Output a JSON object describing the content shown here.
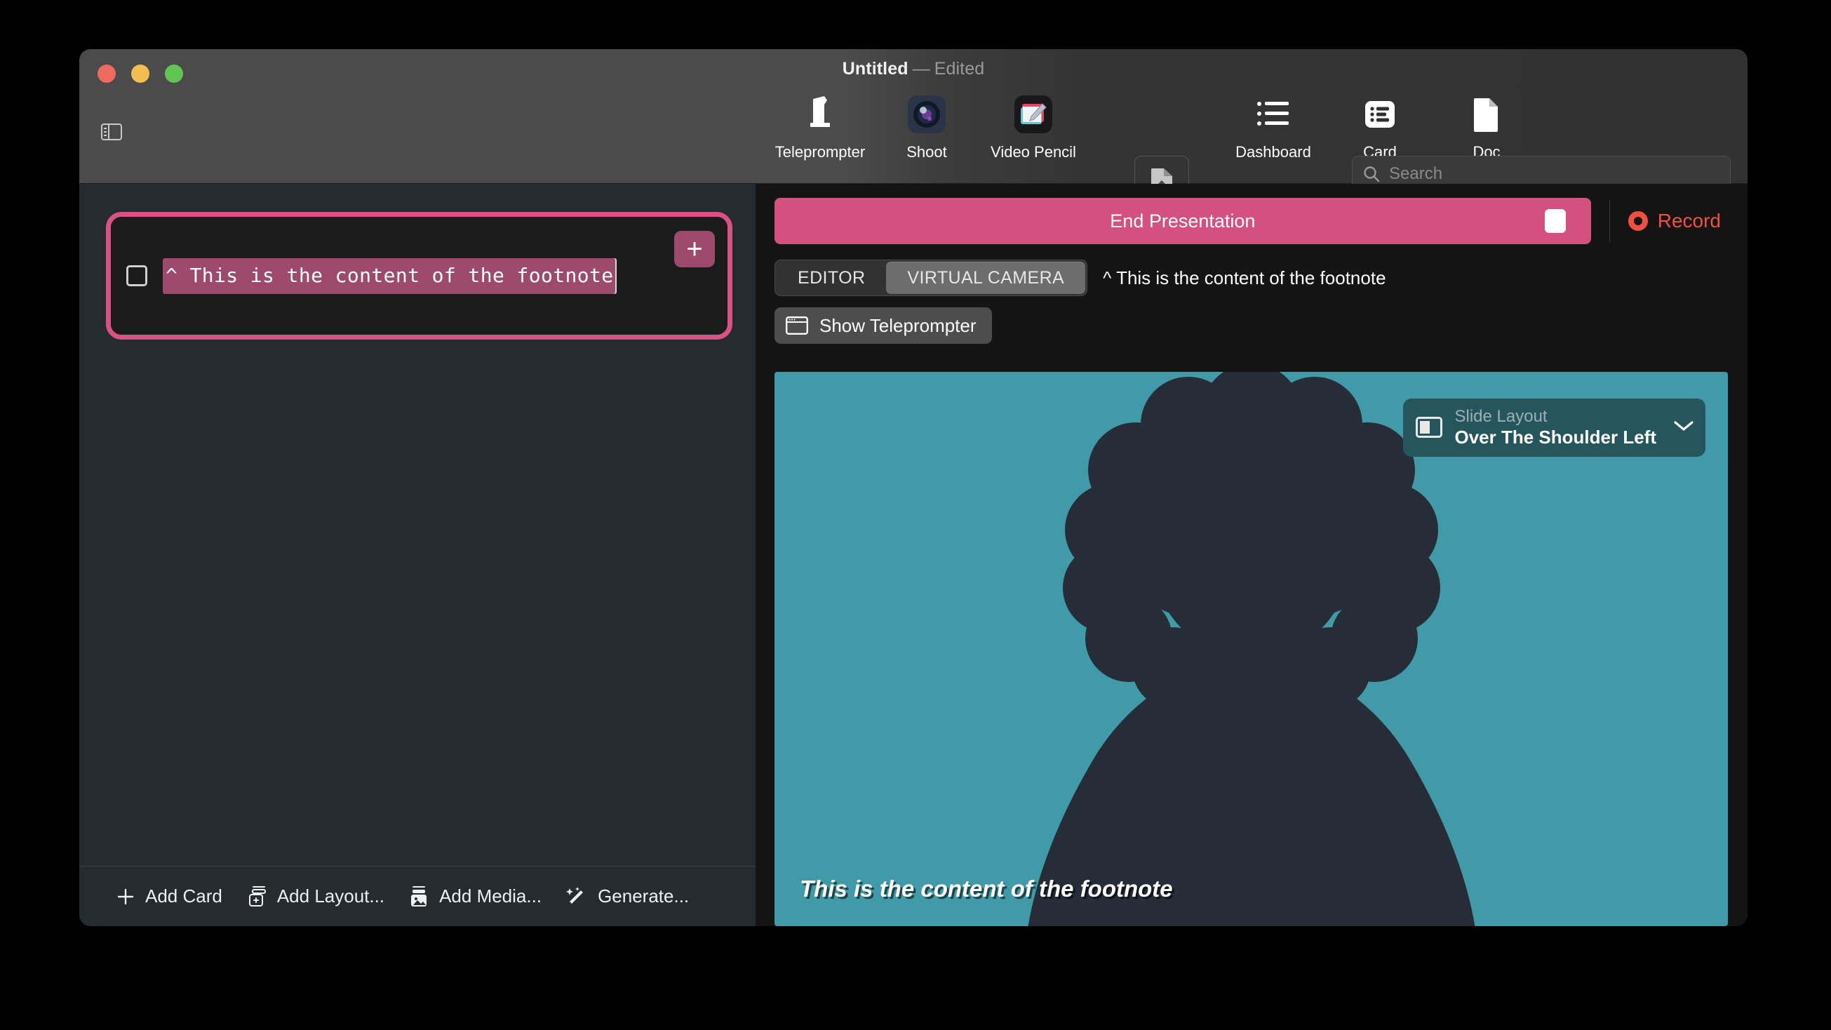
{
  "window": {
    "title": "Untitled",
    "title_separator": "—",
    "title_state": "Edited"
  },
  "toolbar": {
    "sidebar_toggle": "sidebar-toggle",
    "items": [
      {
        "label": "Teleprompter",
        "icon": "teleprompter-icon"
      },
      {
        "label": "Shoot",
        "icon": "camera-lens-icon"
      },
      {
        "label": "Video Pencil",
        "icon": "video-pencil-icon"
      },
      {
        "label": "Dashboard",
        "icon": "dashboard-list-icon"
      },
      {
        "label": "Card",
        "icon": "card-icon"
      },
      {
        "label": "Doc",
        "icon": "doc-icon"
      }
    ],
    "export_icon": "export-document-icon",
    "search": {
      "placeholder": "Search",
      "value": "",
      "icon": "search-icon"
    }
  },
  "left_panel": {
    "card": {
      "checkbox_checked": false,
      "text": "^ This is the content of the footnote",
      "add_label": "+",
      "selected": true
    },
    "toolbar": [
      {
        "label": "Add Card",
        "icon": "plus-icon"
      },
      {
        "label": "Add Layout...",
        "icon": "add-layout-icon"
      },
      {
        "label": "Add Media...",
        "icon": "add-media-icon"
      },
      {
        "label": "Generate...",
        "icon": "magic-wand-icon"
      }
    ]
  },
  "right_panel": {
    "end_presentation": {
      "label": "End Presentation",
      "stop_icon": "stop-square-icon"
    },
    "record": {
      "label": "Record",
      "icon": "record-dot-icon"
    },
    "segmented": {
      "options": [
        "EDITOR",
        "VIRTUAL CAMERA"
      ],
      "selected": "VIRTUAL CAMERA"
    },
    "note_text": "^ This is the content of the footnote",
    "show_teleprompter": {
      "label": "Show Teleprompter",
      "icon": "teleprompter-window-icon"
    },
    "preview": {
      "background_color": "#419aa8",
      "silhouette_color": "#262d38",
      "slide_layout": {
        "title": "Slide Layout",
        "value": "Over The Shoulder Left",
        "icon": "slide-layout-icon",
        "chevron": "chevron-down-icon"
      },
      "caption": "This is the content of the footnote"
    }
  },
  "colors": {
    "accent_pink": "#d4507e",
    "record_red": "#f2503f",
    "preview_teal": "#419aa8",
    "pill_teal": "#25555d"
  }
}
